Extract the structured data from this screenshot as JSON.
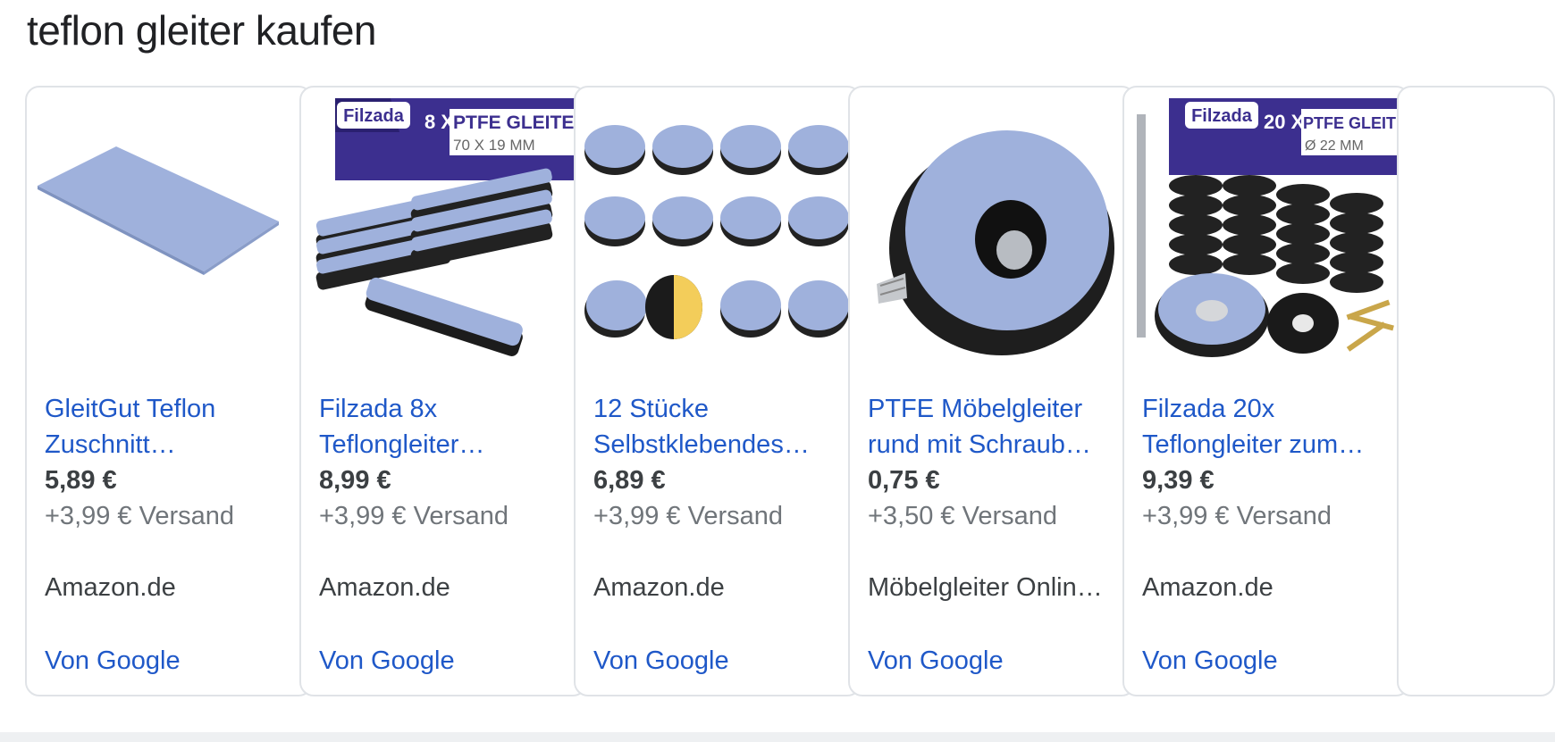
{
  "query_heading": "teflon gleiter kaufen",
  "colors": {
    "link": "#1f58c8",
    "price": "#3c4043",
    "muted": "#70757a",
    "border": "#e0e3e7",
    "ptfe_blue": "#8fa4cf"
  },
  "products": [
    {
      "title_line1": "GleitGut Teflon",
      "title_line2": "Zuschnitt…",
      "price": "5,89 €",
      "shipping": "+3,99 € Versand",
      "merchant": "Amazon.de",
      "source": "Von Google",
      "image_icon": "ptfe-sheet-image"
    },
    {
      "title_line1": "Filzada 8x",
      "title_line2": "Teflongleiter…",
      "price": "8,99 €",
      "shipping": "+3,99 € Versand",
      "merchant": "Amazon.de",
      "source": "Von Google",
      "image_icon": "rectangular-glides-image",
      "image_text": {
        "brand": "Filzada",
        "count": "8 X",
        "label": "PTFE GLEITER",
        "size": "70 X 19 MM"
      }
    },
    {
      "title_line1": "12 Stücke",
      "title_line2": "Selbstklebendes…",
      "price": "6,89 €",
      "shipping": "+3,99 € Versand",
      "merchant": "Amazon.de",
      "source": "Von Google",
      "image_icon": "round-glides-image"
    },
    {
      "title_line1": "PTFE Möbelgleiter",
      "title_line2": "rund mit Schraub…",
      "price": "0,75 €",
      "shipping": "+3,50 € Versand",
      "merchant": "Möbelgleiter Onlin…",
      "source": "Von Google",
      "image_icon": "screw-glide-image"
    },
    {
      "title_line1": "Filzada 20x",
      "title_line2": "Teflongleiter zum…",
      "price": "9,39 €",
      "shipping": "+3,99 € Versand",
      "merchant": "Amazon.de",
      "source": "Von Google",
      "image_icon": "round-screw-glides-image",
      "image_text": {
        "brand": "Filzada",
        "count": "20 X",
        "label": "PTFE GLEITER",
        "size": "Ø 22 MM"
      }
    }
  ]
}
